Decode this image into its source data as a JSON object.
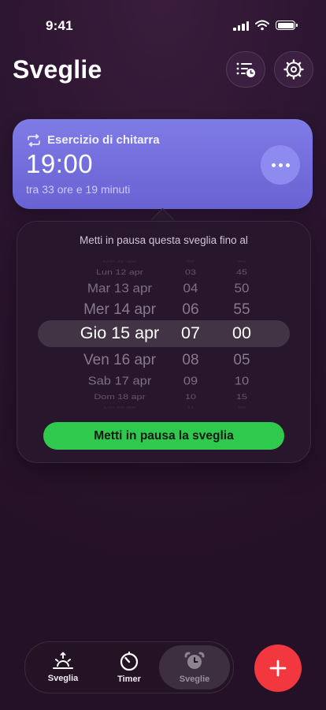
{
  "status": {
    "time": "9:41"
  },
  "header": {
    "title": "Sveglie"
  },
  "alarm": {
    "label": "Esercizio di chitarra",
    "time": "19:00",
    "subtitle": "tra 33 ore e 19 minuti"
  },
  "popover": {
    "title": "Metti in pausa questa sveglia fino al",
    "dates": [
      "Lun 11 apr",
      "Lun 12 apr",
      "Mar 13 apr",
      "Mer 14 apr",
      "Gio 15 apr",
      "Ven 16 apr",
      "Sab 17 apr",
      "Dom 18 apr",
      "Lun 19 apr"
    ],
    "hours": [
      "02",
      "03",
      "04",
      "06",
      "07",
      "08",
      "09",
      "10",
      "11"
    ],
    "minutes": [
      "40",
      "45",
      "50",
      "55",
      "00",
      "05",
      "10",
      "15",
      "20"
    ],
    "selected_index": 4,
    "pause_button": "Metti in pausa la sveglia"
  },
  "tabs": [
    {
      "label": "Sveglia",
      "icon": "sunrise-icon"
    },
    {
      "label": "Timer",
      "icon": "timer-icon"
    },
    {
      "label": "Sveglie",
      "icon": "alarm-clock-icon"
    }
  ],
  "colors": {
    "card": "#7470df",
    "accent_green": "#2fc94d",
    "fab_red": "#f2373f"
  }
}
